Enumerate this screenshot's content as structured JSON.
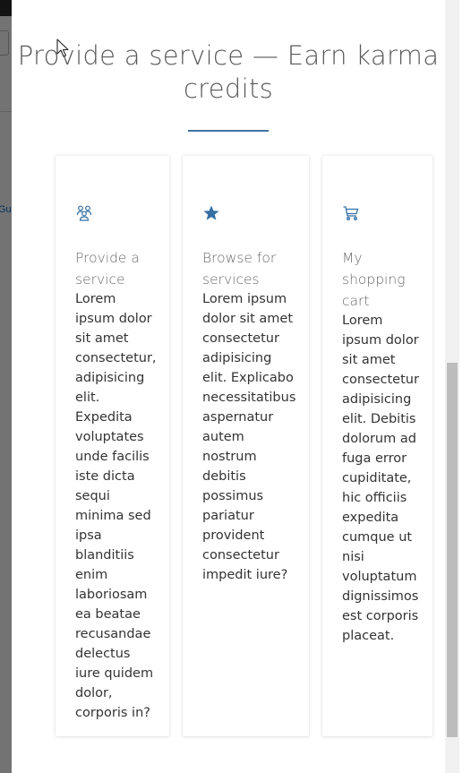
{
  "background": {
    "link_fragment": "Gu"
  },
  "dialog": {
    "title": "Provide a service — Earn karma credits",
    "accent_color": "#3f73a3",
    "cards": [
      {
        "icon": "people-group-icon",
        "title": "Provide a service",
        "body": "Lorem ipsum dolor sit amet consectetur, adipisicing elit. Expedita voluptates unde facilis iste dicta sequi minima sed ipsa blanditiis enim laboriosam ea beatae recusandae delectus iure quidem dolor, corporis in?"
      },
      {
        "icon": "star-icon",
        "title": "Browse for services",
        "body": "Lorem ipsum dolor sit amet consectetur adipisicing elit. Explicabo necessitatibus aspernatur autem nostrum debitis possimus pariatur provident consectetur impedit iure?"
      },
      {
        "icon": "shopping-cart-icon",
        "title": "My shopping cart",
        "body": "Lorem ipsum dolor sit amet consectetur adipisicing elit. Debitis dolorum ad fuga error cupiditate, hic officiis expedita cumque ut nisi voluptatum dignissimos est corporis placeat."
      }
    ]
  }
}
